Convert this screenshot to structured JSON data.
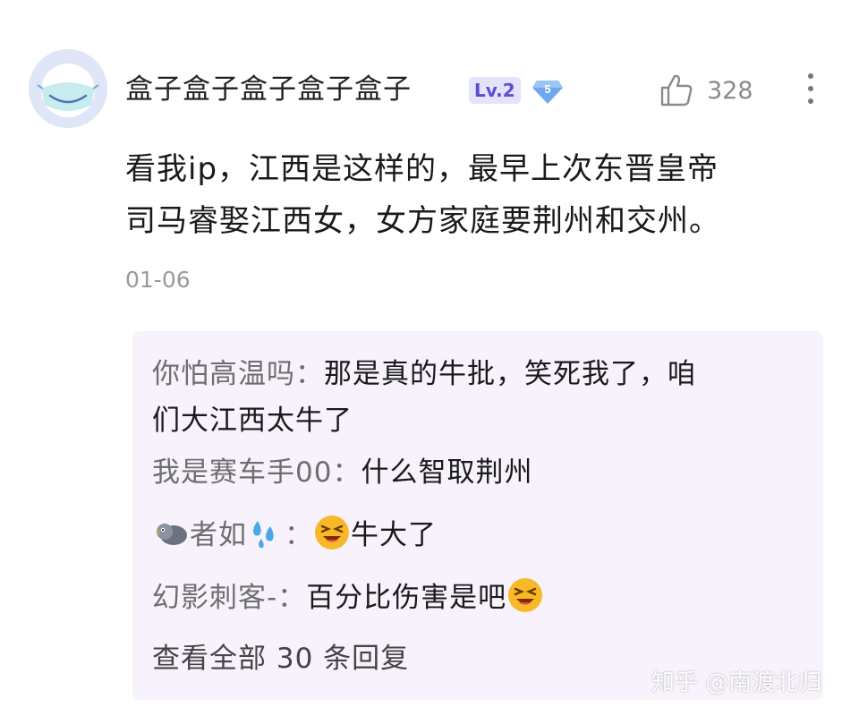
{
  "comment": {
    "username": "盒子盒子盒子盒子盒子",
    "level_badge": "Lv.2",
    "diamond_badge": "5",
    "like_count": "328",
    "content_line1": "看我ip，江西是这样的，最早上次东晋皇帝",
    "content_line2": "司马睿娶江西女，女方家庭要荆州和交州。",
    "date": "01-06"
  },
  "replies": [
    {
      "author": "你怕高温吗：",
      "text_line1": "那是真的牛批，笑死我了，咱",
      "text_line2": "们大江西太牛了"
    },
    {
      "author": "我是赛车手00：",
      "text": "什么智取荆州"
    },
    {
      "author_prefix_icon": "bird-icon",
      "author": "者如",
      "author_suffix_icon": "sweat-drops-icon",
      "author_colon": "：",
      "text_icon": "laughing-emoji-icon",
      "text": "牛大了"
    },
    {
      "author": "幻影刺客-：",
      "text": "百分比伤害是吧",
      "text_icon": "laughing-emoji-icon"
    }
  ],
  "view_all": "查看全部 30 条回复",
  "watermark": "知乎 @南渡北归",
  "colors": {
    "level_badge_bg": "#e5e2fb",
    "level_badge_text": "#5b4fd0",
    "diamond": "#6fa8ef",
    "reply_panel_bg": "#f7f2fc",
    "emoji_yellow": "#f7b928"
  }
}
